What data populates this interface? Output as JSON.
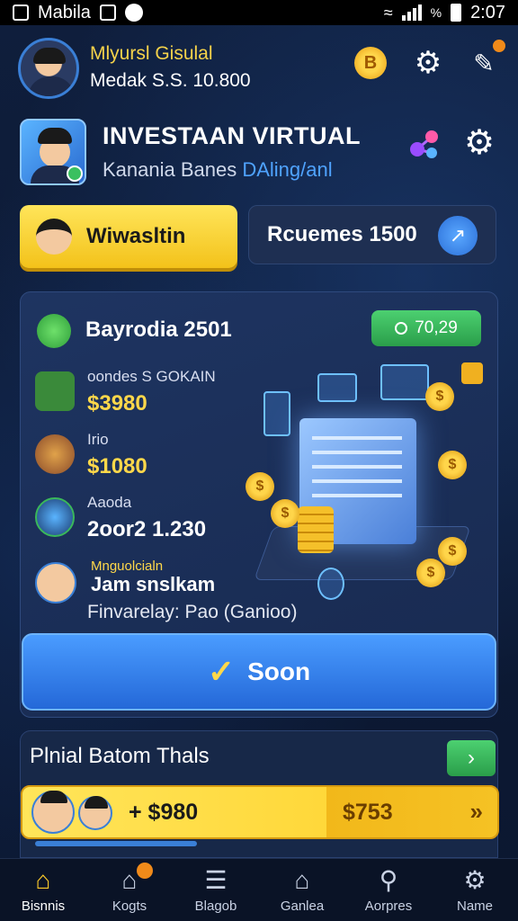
{
  "status_bar": {
    "app_label": "Mabila",
    "time": "2:07",
    "signal_text": "%"
  },
  "header": {
    "user_name": "Mlyursl Gisulal",
    "balance": "Medak S.S. 10.800",
    "coin_symbol": "B"
  },
  "banner": {
    "title": "INVESTAAN VIRTUAL",
    "subtitle_main": "Kanania Banes ",
    "subtitle_highlight": "DAling/anl"
  },
  "actions": {
    "primary_label": "Wiwasltin",
    "secondary_label": "Rcuemes 1500"
  },
  "panel": {
    "title": "Bayrodia 2501",
    "badge": "70,29",
    "stats": [
      {
        "label": "oondes S GOKAIN",
        "value": "$3980"
      },
      {
        "label": "Irio",
        "value": "$1080"
      },
      {
        "label": "Aaoda",
        "value": "2oor2 1.230"
      }
    ],
    "profile": {
      "small": "Mnguolcialn",
      "name": "Jam snslkam",
      "description": "Finvarelay: Pao (Ganioo)"
    }
  },
  "main_action": {
    "label": "Soon"
  },
  "bottom_panel": {
    "title": "Plnial Batom Thals",
    "row_amount": "+ $980",
    "row_value": "$753"
  },
  "nav": [
    {
      "label": "Bisnnis",
      "icon": "home-icon"
    },
    {
      "label": "Kogts",
      "icon": "house-icon"
    },
    {
      "label": "Blagob",
      "icon": "list-icon"
    },
    {
      "label": "Ganlea",
      "icon": "home-icon"
    },
    {
      "label": "Aorpres",
      "icon": "search-icon"
    },
    {
      "label": "Name",
      "icon": "profile-icon"
    }
  ],
  "colors": {
    "accent_yellow": "#ffd84a",
    "accent_blue": "#2b6fd8",
    "accent_green": "#3ab85a",
    "background": "#0d1a33"
  }
}
